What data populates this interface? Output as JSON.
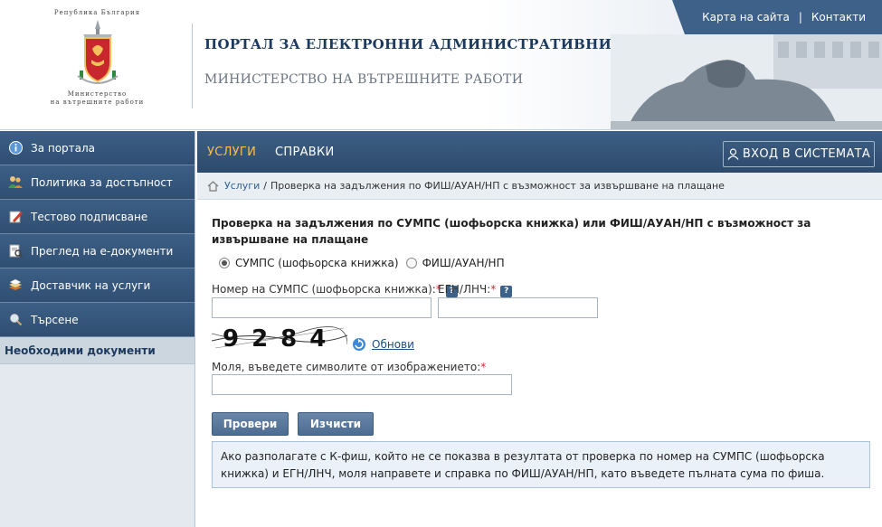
{
  "header": {
    "logo_top": "Република България",
    "logo_bottom_line1": "Министерство",
    "logo_bottom_line2": "на вътрешните работи",
    "portal_title": "ПОРТАЛ ЗА ЕЛЕКТРОННИ АДМИНИСТРАТИВНИ УСЛУГИ",
    "ministry_title": "МИНИСТЕРСТВО НА ВЪТРЕШНИТЕ РАБОТИ",
    "links": {
      "sitemap": "Карта на сайта",
      "separator": "|",
      "contacts": "Контакти"
    }
  },
  "sidebar": {
    "items": [
      {
        "label": "За портала",
        "icon": "info-icon"
      },
      {
        "label": "Политика за достъпност",
        "icon": "people-icon"
      },
      {
        "label": "Тестово подписване",
        "icon": "pen-icon"
      },
      {
        "label": "Преглед на е-документи",
        "icon": "document-search-icon"
      },
      {
        "label": "Доставчик на услуги",
        "icon": "stack-icon"
      },
      {
        "label": "Търсене",
        "icon": "magnifier-icon"
      }
    ],
    "required_docs": "Необходими документи"
  },
  "mainbar": {
    "tab_services": "УСЛУГИ",
    "tab_references": "СПРАВКИ",
    "login": "ВХОД В СИСТЕМАТА"
  },
  "breadcrumb": {
    "home": "Услуги",
    "separator": "/",
    "current": "Проверка на задължения по ФИШ/АУАН/НП с възможност за извършване на плащане"
  },
  "form": {
    "title": "Проверка на задължения по СУМПС (шофьорска книжка) или ФИШ/АУАН/НП с възможност за извършване на плащане",
    "radio_sumps": "СУМПС (шофьорска книжка)",
    "radio_fish": "ФИШ/АУАН/НП",
    "label_sumps_number": "Номер на СУМПС (шофьорска книжка):",
    "label_egn": "ЕГН/ЛНЧ:",
    "required_mark": "*",
    "help_mark": "?",
    "sumps_value": "",
    "egn_value": "",
    "captcha_text": "9284",
    "refresh": "Обнови",
    "label_captcha": "Моля, въведете символите от изображението:",
    "captcha_value": "",
    "btn_check": "Провери",
    "btn_clear": "Изчисти",
    "info": "Ако разполагате с К-фиш, който не се показва в резултата от проверка по номер на СУМПС (шофьорска книжка) и ЕГН/ЛНЧ, моля направете и справка по ФИШ/АУАН/НП, като въведете пълната сума по фиша."
  },
  "colors": {
    "nav_blue": "#3d5f85",
    "accent_orange": "#f7c04b",
    "link_blue": "#2d5f93"
  }
}
